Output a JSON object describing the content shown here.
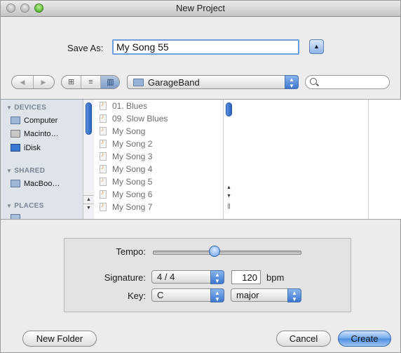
{
  "window": {
    "title": "New Project"
  },
  "save_as": {
    "label": "Save As:",
    "value": "My Song 55"
  },
  "toolbar": {
    "back_glyph": "◀",
    "forward_glyph": "▶",
    "view_icon_glyph": "⊞",
    "view_list_glyph": "≡",
    "view_column_glyph": "▥",
    "location": "GarageBand",
    "search_placeholder": ""
  },
  "sidebar": {
    "sections": [
      {
        "title": "DEVICES",
        "items": [
          "Computer",
          "Macinto…",
          "iDisk"
        ]
      },
      {
        "title": "SHARED",
        "items": [
          "MacBoo…"
        ]
      },
      {
        "title": "PLACES",
        "items": []
      }
    ]
  },
  "files": [
    "01. Blues",
    "09. Slow Blues",
    "My Song",
    "My Song 2",
    "My Song 3",
    "My Song 4",
    "My Song 5",
    "My Song 6",
    "My Song 7"
  ],
  "settings": {
    "tempo_label": "Tempo:",
    "tempo_level": 0.42,
    "signature_label": "Signature:",
    "signature_value": "4 / 4",
    "bpm_value": "120",
    "bpm_unit": "bpm",
    "key_label": "Key:",
    "key_value": "C",
    "scale_value": "major"
  },
  "buttons": {
    "new_folder": "New Folder",
    "cancel": "Cancel",
    "create": "Create"
  },
  "colors": {
    "accent": "#4f8de0",
    "sidebar_bg": "#dfe4ea",
    "window_bg": "#ececec"
  }
}
